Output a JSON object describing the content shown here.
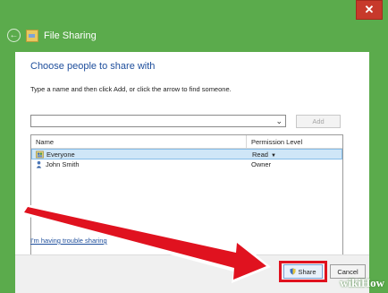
{
  "window": {
    "title": "File Sharing",
    "close_glyph": "✕",
    "back_glyph": "←"
  },
  "dialog": {
    "heading": "Choose people to share with",
    "instructions": "Type a name and then click Add, or click the arrow to find someone.",
    "name_input": {
      "value": "",
      "placeholder": ""
    },
    "add_label": "Add",
    "table": {
      "columns": [
        "Name",
        "Permission Level"
      ],
      "rows": [
        {
          "name": "Everyone",
          "permission": "Read",
          "selected": true,
          "icon": "group-icon"
        },
        {
          "name": "John Smith",
          "permission": "Owner",
          "selected": false,
          "icon": "user-icon"
        }
      ]
    },
    "trouble_link": "I'm having trouble sharing",
    "share_label": "Share",
    "cancel_label": "Cancel"
  },
  "watermark": {
    "wiki": "wiki",
    "how": "How"
  },
  "colors": {
    "background": "#5bab4c",
    "accent": "#1e4e9c",
    "highlight": "#e0121f"
  }
}
